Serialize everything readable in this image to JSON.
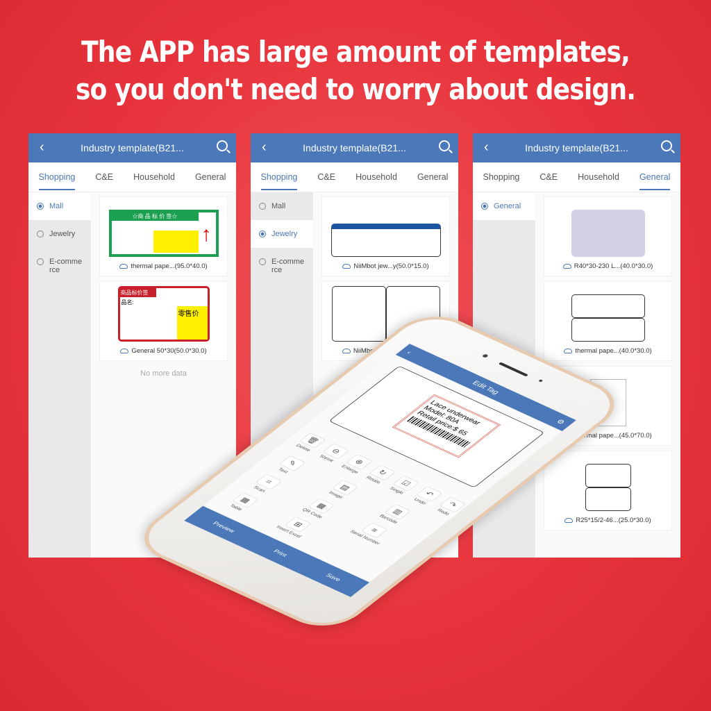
{
  "headline": [
    "The APP has large amount of templates,",
    "so you don't need to worry about design."
  ],
  "colors": {
    "accent": "#4a78b8",
    "background": "#e8343c"
  },
  "panels": [
    {
      "title": "Industry template(B21...",
      "tabs": [
        "Shopping",
        "C&E",
        "Household",
        "General"
      ],
      "active_tab": 0,
      "side": [
        {
          "label": "Mall",
          "on": true
        },
        {
          "label": "Jewelry",
          "on": false
        },
        {
          "label": "E-comme rce",
          "on": false
        }
      ],
      "cards": [
        "thermal pape...(95.0*40.0)",
        "General 50*30(50.0*30.0)"
      ],
      "footer": "No more data",
      "thumb_text": {
        "t1": "☆商 品 标 价 签☆",
        "t2": "商品标价签",
        "t3": "品名:",
        "t4": "零售价"
      }
    },
    {
      "title": "Industry template(B21...",
      "tabs": [
        "Shopping",
        "C&E",
        "Household",
        "General"
      ],
      "active_tab": 0,
      "side": [
        {
          "label": "Mall",
          "on": false
        },
        {
          "label": "Jewelry",
          "on": true
        },
        {
          "label": "E-comme rce",
          "on": false
        }
      ],
      "cards": [
        "NiiMbot jew...y(50.0*15.0)",
        "NiiMbot jewe...(50.0*30.0)"
      ]
    },
    {
      "title": "Industry template(B21...",
      "tabs": [
        "Shopping",
        "C&E",
        "Household",
        "General"
      ],
      "active_tab": 3,
      "side": [
        {
          "label": "General",
          "on": true
        }
      ],
      "cards": [
        "R40*30-230 L...(40.0*30.0)",
        "thermal pape...(40.0*30.0)",
        "thermal pape...(45.0*70.0)",
        "R25*15/2-46...(25.0*30.0)"
      ]
    }
  ],
  "phone": {
    "title": "Edit Tag",
    "label_lines": [
      "Lace underwear",
      "Model: 80A",
      "Retail price:$ 65"
    ],
    "quick_tools": [
      "Delete",
      "Shrink",
      "Enlarge",
      "Rotate",
      "Single",
      "Undo",
      "Redo"
    ],
    "tools": [
      "Text",
      "Image",
      "Barcode",
      "Scan",
      "QR Code",
      "Serial Number",
      "Table",
      "Insert Excel"
    ],
    "bottom": [
      "Preview",
      "Print",
      "Save"
    ]
  }
}
